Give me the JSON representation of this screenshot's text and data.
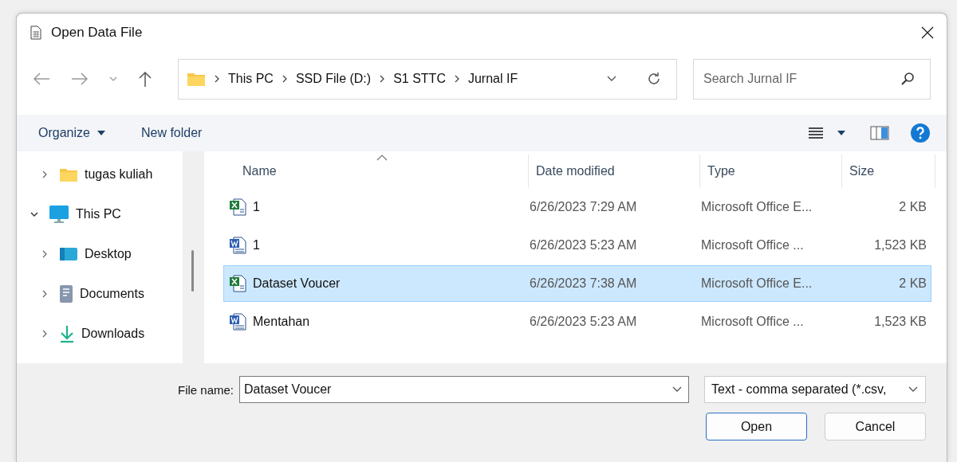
{
  "window": {
    "title": "Open Data File"
  },
  "address_bar": {
    "path": [
      "This PC",
      "SSD File (D:)",
      "S1 STTC",
      "Jurnal IF"
    ]
  },
  "search": {
    "placeholder": "Search Jurnal IF"
  },
  "command_bar": {
    "organize": "Organize",
    "new_folder": "New folder"
  },
  "nav_tree": [
    {
      "label": "tugas kuliah",
      "kind": "folder",
      "expanded": false
    },
    {
      "label": "This PC",
      "kind": "pc",
      "expanded": true,
      "children": [
        {
          "label": "Desktop",
          "kind": "desktop",
          "expanded": false
        },
        {
          "label": "Documents",
          "kind": "documents",
          "expanded": false
        },
        {
          "label": "Downloads",
          "kind": "downloads",
          "expanded": false
        }
      ]
    }
  ],
  "file_list": {
    "columns": [
      "Name",
      "Date modified",
      "Type",
      "Size"
    ],
    "rows": [
      {
        "kind": "excel",
        "name": "1",
        "date": "6/26/2023 7:29 AM",
        "type": "Microsoft Office E...",
        "size": "2 KB",
        "selected": false
      },
      {
        "kind": "word",
        "name": "1",
        "date": "6/26/2023 5:23 AM",
        "type": "Microsoft Office ...",
        "size": "1,523 KB",
        "selected": false
      },
      {
        "kind": "excel",
        "name": "Dataset Voucer",
        "date": "6/26/2023 7:38 AM",
        "type": "Microsoft Office E...",
        "size": "2 KB",
        "selected": true
      },
      {
        "kind": "word",
        "name": "Mentahan",
        "date": "6/26/2023 5:23 AM",
        "type": "Microsoft Office ...",
        "size": "1,523 KB",
        "selected": false
      }
    ]
  },
  "file_name": {
    "label": "File name:",
    "value": "Dataset Voucer"
  },
  "file_type": {
    "value": "Text - comma separated (*.csv,"
  },
  "buttons": [
    "Open",
    "Cancel"
  ]
}
